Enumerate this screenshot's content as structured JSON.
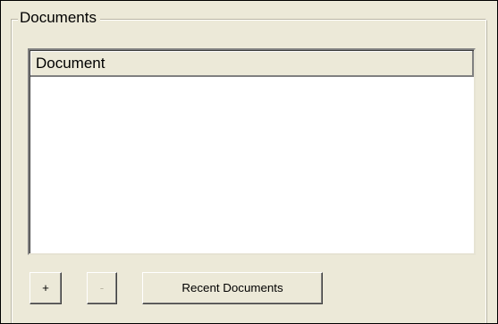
{
  "documents_group": {
    "legend": "Documents",
    "list": {
      "column_header": "Document",
      "rows": []
    },
    "buttons": {
      "add_label": "+",
      "remove_label": "-",
      "recent_label": "Recent Documents"
    }
  },
  "colors": {
    "background": "#ece9d8",
    "list_background": "#ffffff",
    "disabled_text": "#b9b5a3"
  }
}
